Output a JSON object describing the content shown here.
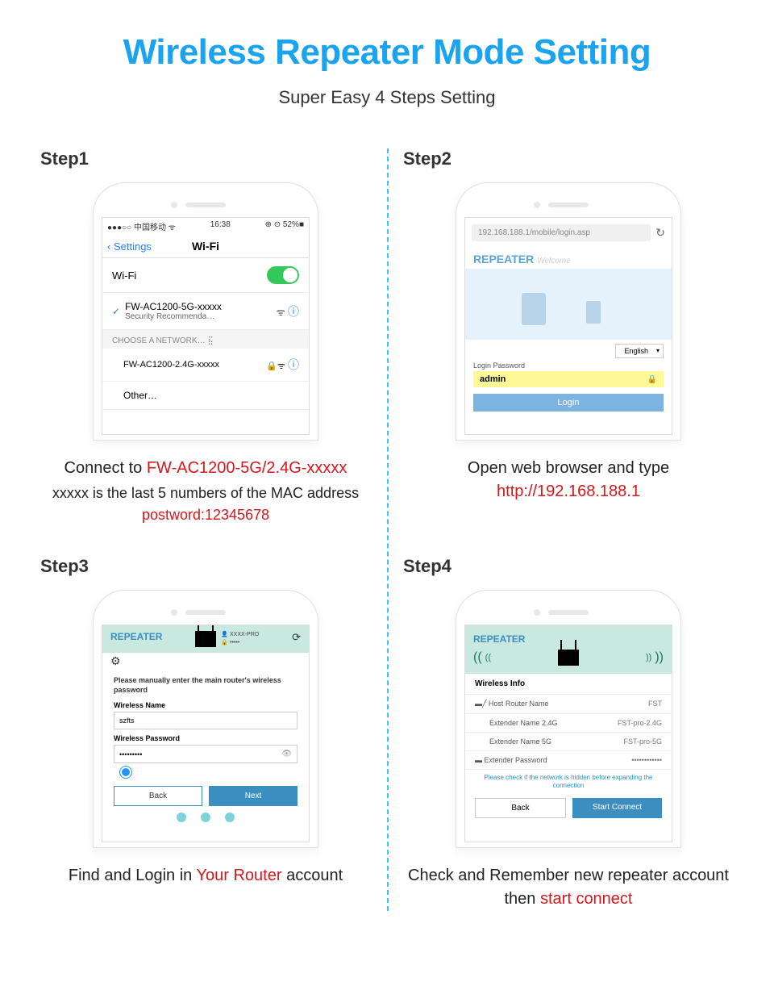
{
  "header": {
    "title": "Wireless Repeater Mode Setting",
    "subtitle": "Super Easy 4 Steps Setting"
  },
  "step1": {
    "label": "Step1",
    "status": {
      "carrier": "●●●○○ 中国移动 ᯤ",
      "time": "16:38",
      "right": "⊕ ⊙ 52%■"
    },
    "nav_back": "Settings",
    "nav_title": "Wi-Fi",
    "wifi_row": "Wi-Fi",
    "ssid_main": "FW-AC1200-5G-xxxxx",
    "ssid_main_sub": "Security Recommenda…",
    "choose_header": "CHOOSE A NETWORK…",
    "ssid_alt": "FW-AC1200-2.4G-xxxxx",
    "other": "Other…",
    "caption_pre": "Connect to ",
    "caption_red": "FW-AC1200-5G/2.4G-xxxxx",
    "sub_caption": "xxxxx is the last 5 numbers of the MAC address",
    "password": "postword:12345678"
  },
  "step2": {
    "label": "Step2",
    "url": "192.168.188.1/mobile/login.asp",
    "brand": "REPEATER",
    "welcome": "Welcome",
    "lang": "English",
    "login_label": "Login Password",
    "admin": "admin",
    "login_btn": "Login",
    "caption_pre": "Open web browser and type",
    "caption_url": "http://192.168.188.1"
  },
  "step3": {
    "label": "Step3",
    "brand": "REPEATER",
    "cred_user": "XXXX-PRO",
    "cred_pw": "•••••",
    "hint": "Please manually enter the main router's wireless password",
    "name_lbl": "Wireless Name",
    "name_val": "szfts",
    "pw_lbl": "Wireless Password",
    "pw_val": "•••••••••",
    "back": "Back",
    "next": "Next",
    "caption_pre": "Find and Login in ",
    "caption_red": "Your Router",
    "caption_post": " account"
  },
  "step4": {
    "label": "Step4",
    "brand": "REPEATER",
    "section": "Wireless Info",
    "rows": {
      "host_l": "Host Router Name",
      "host_r": "FST",
      "e24_l": "Extender Name 2.4G",
      "e24_r": "FST-pro-2.4G",
      "e5_l": "Extender Name 5G",
      "e5_r": "FST-pro-5G",
      "pw_l": "Extender Password",
      "pw_r": "••••••••••••"
    },
    "note": "Please check if the network is hidden before expanding the connection",
    "back": "Back",
    "connect": "Start Connect",
    "caption_pre": "Check and Remember new repeater account then ",
    "caption_red": "start connect"
  }
}
